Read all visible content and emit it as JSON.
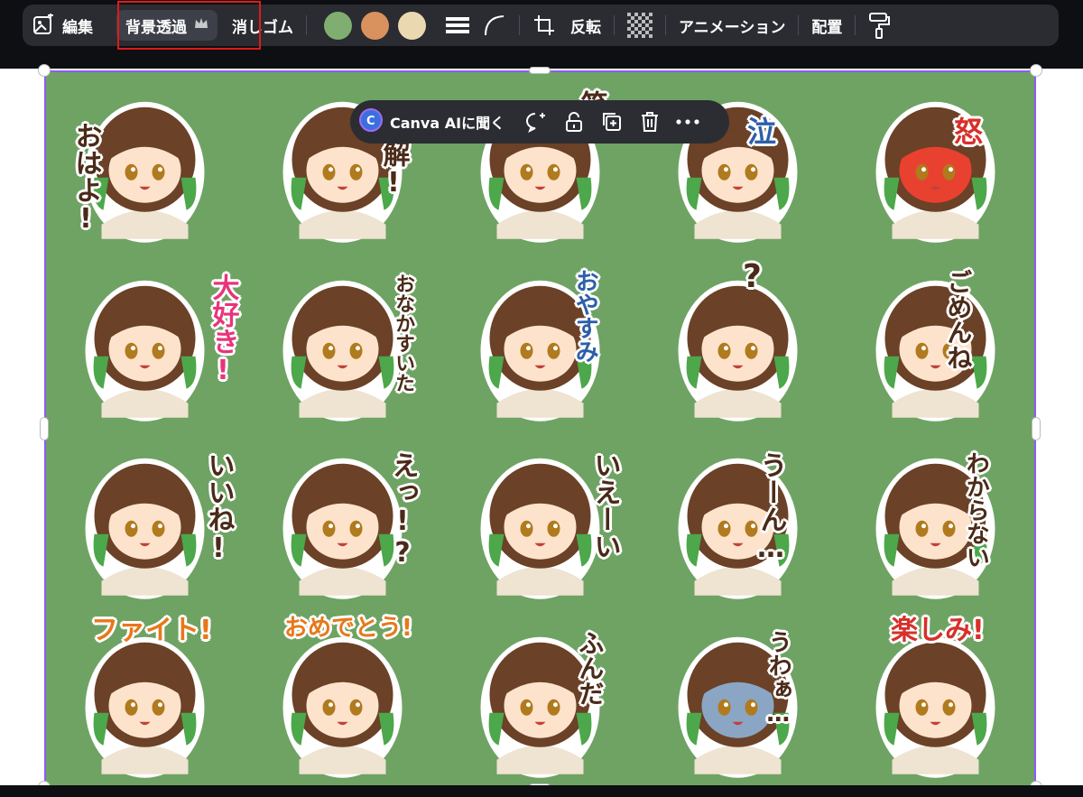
{
  "toolbar": {
    "edit_label": "編集",
    "bg_remove_label": "背景透過",
    "eraser_label": "消しゴム",
    "colors": [
      "#7fae70",
      "#d9915e",
      "#ead9b0"
    ],
    "flip_label": "反転",
    "animation_label": "アニメーション",
    "position_label": "配置"
  },
  "ai_bar": {
    "ask_label": "Canva AIに聞く"
  },
  "stickers": [
    {
      "label": "おはよ!"
    },
    {
      "label": "了解!"
    },
    {
      "label": "笑"
    },
    {
      "label": "泣"
    },
    {
      "label": "怒"
    },
    {
      "label": "大好き!"
    },
    {
      "label": "おなかすいた"
    },
    {
      "label": "おやすみ"
    },
    {
      "label": "?"
    },
    {
      "label": "ごめんね"
    },
    {
      "label": "いいね!"
    },
    {
      "label": "えっ!?"
    },
    {
      "label": "いえーい"
    },
    {
      "label": "うーん…"
    },
    {
      "label": "わからない"
    },
    {
      "label": "ファイト!"
    },
    {
      "label": "おめでとう!"
    },
    {
      "label": "ふんだ"
    },
    {
      "label": "うわぁ…"
    },
    {
      "label": "楽しみ!"
    }
  ]
}
